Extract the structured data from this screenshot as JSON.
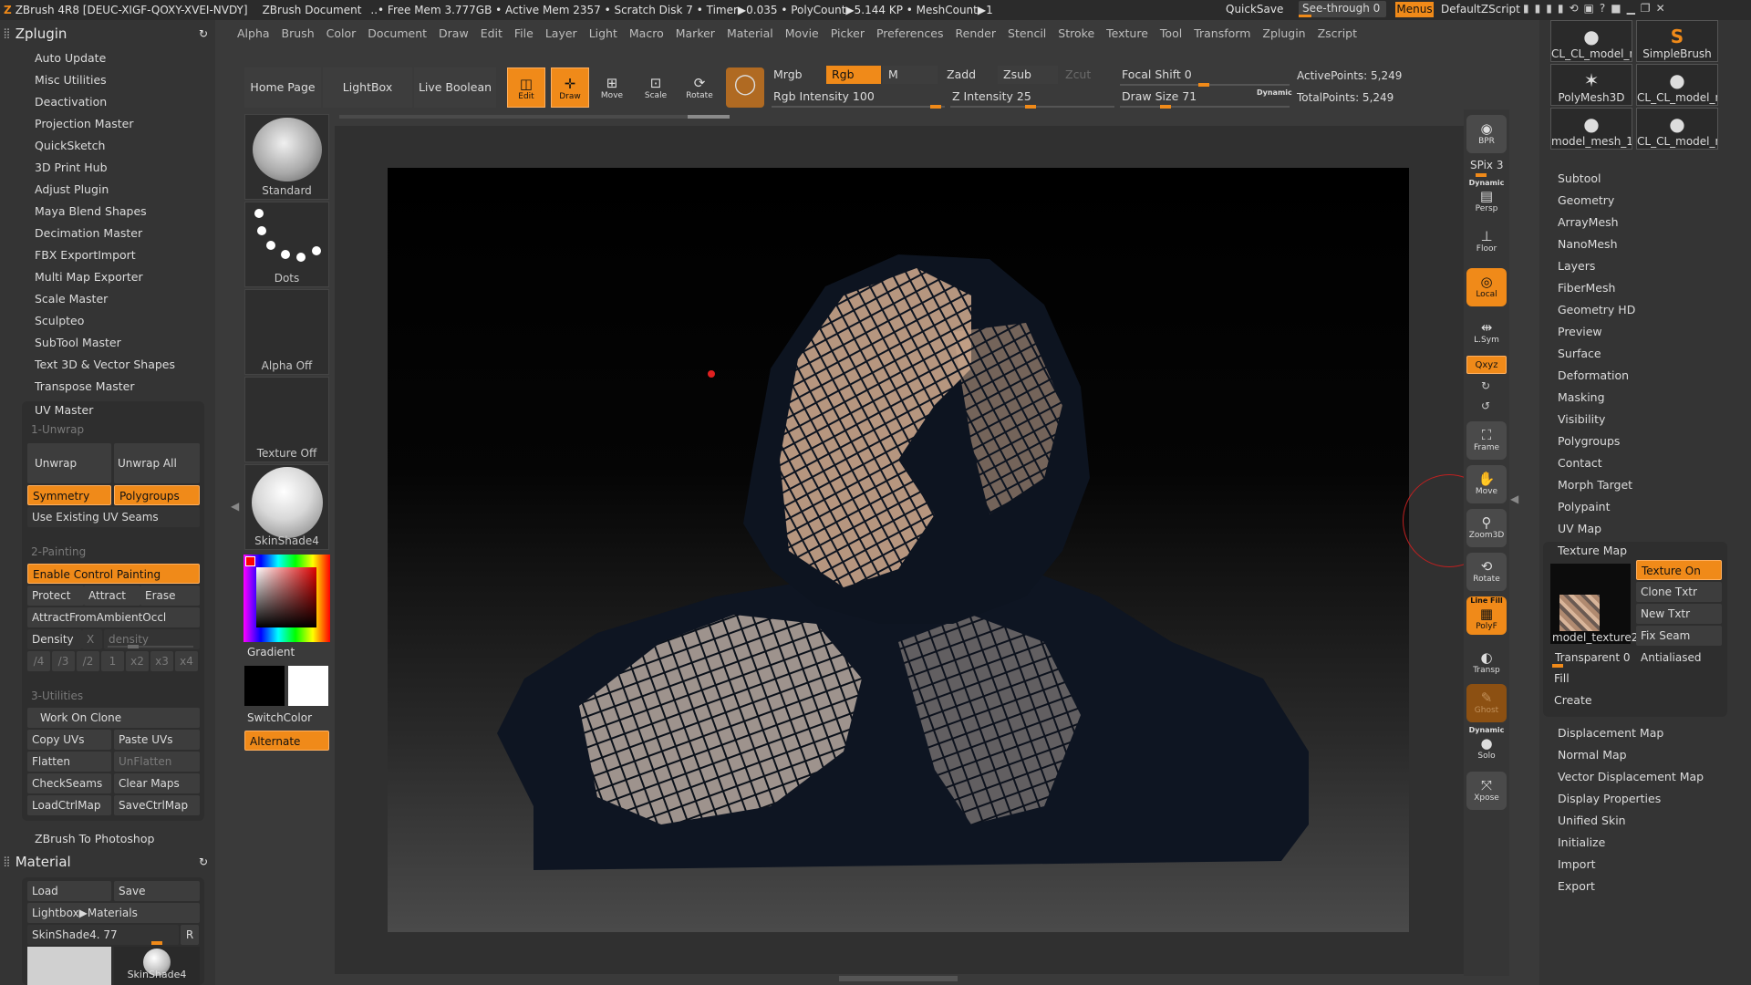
{
  "titlebar": {
    "app": "ZBrush 4R8 [DEUC-XIGF-QOXY-XVEI-NVDY]",
    "doc": "ZBrush Document",
    "stats": "..• Free Mem 3.777GB • Active Mem 2357 • Scratch Disk 7 •  Timer▶0.035 • PolyCount▶5.144 KP  • MeshCount▶1",
    "quicksave": "QuickSave",
    "see_through": "See-through  0",
    "menus": "Menus",
    "script": "DefaultZScript"
  },
  "menubar": [
    "Alpha",
    "Brush",
    "Color",
    "Document",
    "Draw",
    "Edit",
    "File",
    "Layer",
    "Light",
    "Macro",
    "Marker",
    "Material",
    "Movie",
    "Picker",
    "Preferences",
    "Render",
    "Stencil",
    "Stroke",
    "Texture",
    "Tool",
    "Transform",
    "Zplugin",
    "Zscript"
  ],
  "zplugin": {
    "title": "Zplugin",
    "items": [
      "Auto Update",
      "Misc Utilities",
      "Deactivation",
      "Projection Master",
      "QuickSketch",
      "3D Print Hub",
      "Adjust Plugin",
      "Maya Blend Shapes",
      "Decimation Master",
      "FBX ExportImport",
      "Multi Map Exporter",
      "Scale Master",
      "Sculpteo",
      "SubTool Master",
      "Text 3D & Vector Shapes",
      "Transpose Master"
    ],
    "uv_master": {
      "title": "UV Master",
      "unwrap_section": "1-Unwrap",
      "unwrap": "Unwrap",
      "unwrap_all": "Unwrap All",
      "symmetry": "Symmetry",
      "polygroups": "Polygroups",
      "use_existing": "Use Existing UV Seams",
      "painting_section": "2-Painting",
      "enable_control": "Enable Control Painting",
      "protect": "Protect",
      "attract": "Attract",
      "erase": "Erase",
      "attract_ambient": "AttractFromAmbientOccl",
      "density": "Density",
      "density_x": "X",
      "density_slider": "density",
      "density_btns": [
        "/4",
        "/3",
        "/2",
        "1",
        "x2",
        "x3",
        "x4"
      ],
      "utilities_section": "3-Utilities",
      "work_on_clone": "Work On Clone",
      "copy_uvs": "Copy UVs",
      "paste_uvs": "Paste UVs",
      "flatten": "Flatten",
      "unflatten": "UnFlatten",
      "check_seams": "CheckSeams",
      "clear_maps": "Clear Maps",
      "load_ctrl": "LoadCtrlMap",
      "save_ctrl": "SaveCtrlMap"
    },
    "zbrush_to_ps": "ZBrush To Photoshop"
  },
  "material": {
    "title": "Material",
    "load": "Load",
    "save": "Save",
    "lightbox": "Lightbox▶Materials",
    "current": "SkinShade4. 77",
    "r": "R",
    "thumb_label": "SkinShade4"
  },
  "brushcol": {
    "standard": "Standard",
    "dots": "Dots",
    "alpha": "Alpha Off",
    "texture": "Texture Off",
    "skinshade": "SkinShade4",
    "gradient": "Gradient",
    "switchcolor": "SwitchColor",
    "alternate": "Alternate"
  },
  "toolbar": {
    "home": "Home Page",
    "lightbox": "LightBox",
    "live_boolean": "Live Boolean",
    "edit": "Edit",
    "draw": "Draw",
    "move": "Move",
    "scale": "Scale",
    "rotate": "Rotate",
    "mrgb": "Mrgb",
    "rgb": "Rgb",
    "m": "M",
    "zadd": "Zadd",
    "zsub": "Zsub",
    "zcut": "Zcut",
    "rgb_intensity": "Rgb Intensity 100",
    "z_intensity": "Z Intensity 25",
    "focal_shift": "Focal Shift 0",
    "draw_size": "Draw Size 71",
    "dynamic": "Dynamic",
    "active_points": "ActivePoints: 5,249",
    "total_points": "TotalPoints: 5,249"
  },
  "shelf": {
    "bpr": "BPR",
    "spix": "SPix 3",
    "persp_top": "Dynamic",
    "persp": "Persp",
    "floor": "Floor",
    "local": "Local",
    "lsym": "L.Sym",
    "xyz": "Qxyz",
    "frame": "Frame",
    "move": "Move",
    "zoom3d": "Zoom3D",
    "rotate": "Rotate",
    "polyf_top": "Line Fill",
    "polyf": "PolyF",
    "transp": "Transp",
    "ghost": "Ghost",
    "solo_top": "Dynamic",
    "solo": "Solo",
    "xpose": "Xpose"
  },
  "tools": {
    "thumbs": [
      "CL_CL_model_me",
      "SimpleBrush",
      "PolyMesh3D",
      "CL_CL_model_me",
      "model_mesh_1",
      "CL_CL_model_mesh_"
    ],
    "items": [
      "Subtool",
      "Geometry",
      "ArrayMesh",
      "NanoMesh",
      "Layers",
      "FiberMesh",
      "Geometry HD",
      "Preview",
      "Surface",
      "Deformation",
      "Masking",
      "Visibility",
      "Polygroups",
      "Contact",
      "Morph Target",
      "Polypaint",
      "UV Map"
    ],
    "texture_map": {
      "title": "Texture Map",
      "texture_on": "Texture On",
      "clone_txtr": "Clone Txtr",
      "new_txtr": "New Txtr",
      "fix_seam": "Fix Seam",
      "thumb": "model_texture2",
      "transparent": "Transparent 0",
      "antialiased": "Antialiased",
      "fill": "Fill",
      "create": "Create"
    },
    "more": [
      "Displacement Map",
      "Normal Map",
      "Vector Displacement Map",
      "Display Properties",
      "Unified Skin",
      "Initialize",
      "Import",
      "Export"
    ]
  },
  "colors": {
    "accent": "#f08a19",
    "panel": "#343434",
    "bg": "#3a3a3a"
  }
}
